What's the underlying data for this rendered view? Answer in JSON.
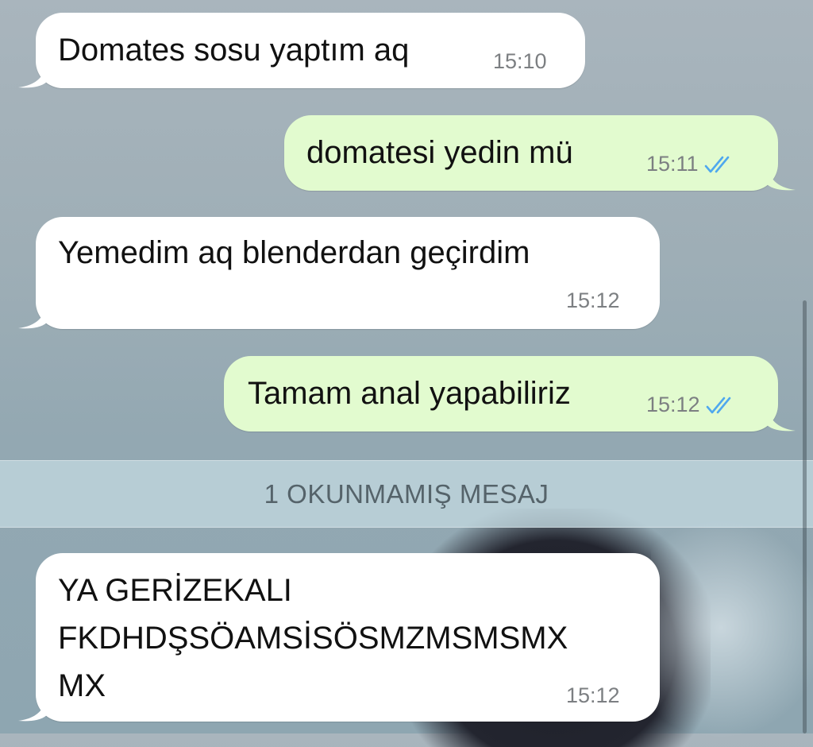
{
  "chat": {
    "messages": [
      {
        "direction": "incoming",
        "text_lines": [
          "Domates sosu yaptım aq"
        ],
        "time": "15:10"
      },
      {
        "direction": "outgoing",
        "text_lines": [
          "domatesi yedin mü"
        ],
        "time": "15:11",
        "read_receipt": "double-check-icon"
      },
      {
        "direction": "incoming",
        "text_lines": [
          "Yemedim aq blenderdan geçirdim"
        ],
        "time": "15:12"
      },
      {
        "direction": "outgoing",
        "text_lines": [
          "Tamam anal yapabiliriz"
        ],
        "time": "15:12",
        "read_receipt": "double-check-icon"
      },
      {
        "direction": "incoming",
        "text_lines": [
          "YA GERİZEKALI",
          "FKDHDŞSÖAMSİSÖSMZMSMSMX",
          "MX"
        ],
        "time": "15:12"
      }
    ],
    "unread_divider": "1 OKUNMAMIŞ MESAJ"
  },
  "colors": {
    "incoming_bubble": "#ffffff",
    "outgoing_bubble": "#e2fbcf",
    "read_tick": "#4fa8ee",
    "timestamp": "#7c7f82"
  }
}
